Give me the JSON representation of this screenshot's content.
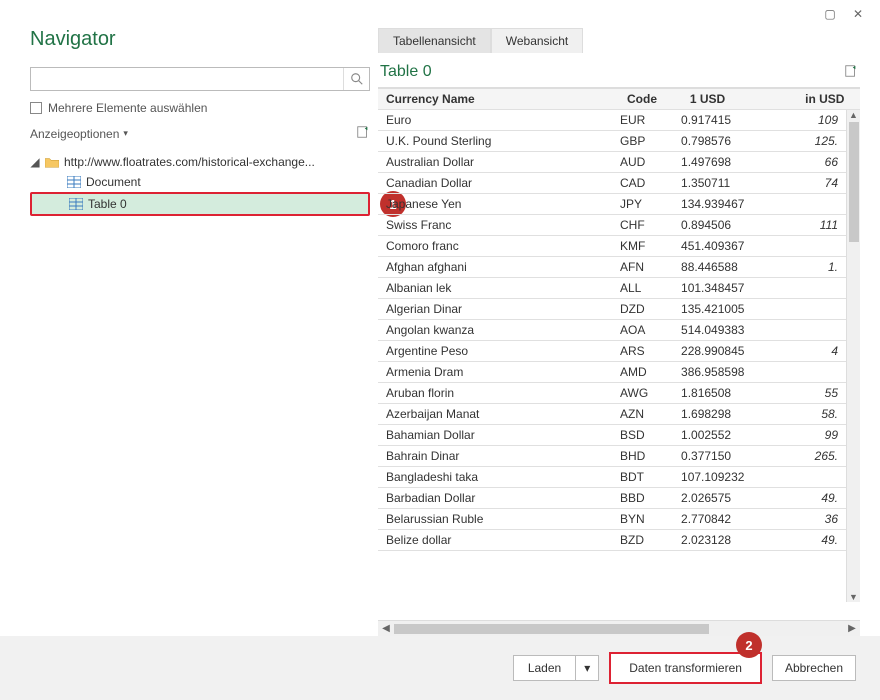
{
  "window": {
    "restore_icon": "▢",
    "close_icon": "✕"
  },
  "sidebar": {
    "title": "Navigator",
    "search_placeholder": "",
    "multi_select_label": "Mehrere Elemente auswählen",
    "display_options_label": "Anzeigeoptionen",
    "tree": {
      "url_label": "http://www.floatrates.com/historical-exchange...",
      "document_label": "Document",
      "table_label": "Table 0"
    },
    "callout1": "1"
  },
  "preview": {
    "tabs": {
      "table_view": "Tabellenansicht",
      "web_view": "Webansicht"
    },
    "title": "Table 0",
    "columns": [
      "Currency Name",
      "Code",
      "1 USD",
      "in USD"
    ],
    "rows": [
      [
        "Euro",
        "EUR",
        "0.917415",
        "109"
      ],
      [
        "U.K. Pound Sterling",
        "GBP",
        "0.798576",
        "125."
      ],
      [
        "Australian Dollar",
        "AUD",
        "1.497698",
        "66"
      ],
      [
        "Canadian Dollar",
        "CAD",
        "1.350711",
        "74"
      ],
      [
        "Japanese Yen",
        "JPY",
        "134.939467",
        ""
      ],
      [
        "Swiss Franc",
        "CHF",
        "0.894506",
        "111"
      ],
      [
        "Comoro franc",
        "KMF",
        "451.409367",
        ""
      ],
      [
        "Afghan afghani",
        "AFN",
        "88.446588",
        "1."
      ],
      [
        "Albanian lek",
        "ALL",
        "101.348457",
        ""
      ],
      [
        "Algerian Dinar",
        "DZD",
        "135.421005",
        ""
      ],
      [
        "Angolan kwanza",
        "AOA",
        "514.049383",
        ""
      ],
      [
        "Argentine Peso",
        "ARS",
        "228.990845",
        "4"
      ],
      [
        "Armenia Dram",
        "AMD",
        "386.958598",
        ""
      ],
      [
        "Aruban florin",
        "AWG",
        "1.816508",
        "55"
      ],
      [
        "Azerbaijan Manat",
        "AZN",
        "1.698298",
        "58."
      ],
      [
        "Bahamian Dollar",
        "BSD",
        "1.002552",
        "99"
      ],
      [
        "Bahrain Dinar",
        "BHD",
        "0.377150",
        "265."
      ],
      [
        "Bangladeshi taka",
        "BDT",
        "107.109232",
        ""
      ],
      [
        "Barbadian Dollar",
        "BBD",
        "2.026575",
        "49."
      ],
      [
        "Belarussian Ruble",
        "BYN",
        "2.770842",
        "36"
      ],
      [
        "Belize dollar",
        "BZD",
        "2.023128",
        "49."
      ]
    ]
  },
  "footer": {
    "load_label": "Laden",
    "transform_label": "Daten transformieren",
    "cancel_label": "Abbrechen",
    "callout2": "2"
  }
}
